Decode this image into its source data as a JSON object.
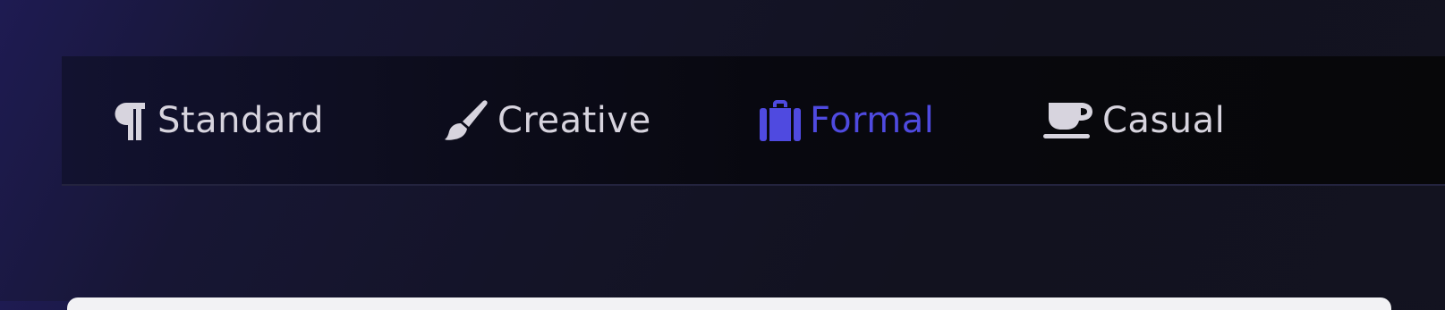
{
  "tabs": [
    {
      "id": "standard",
      "label": "Standard",
      "icon": "paragraph-icon",
      "active": false
    },
    {
      "id": "creative",
      "label": "Creative",
      "icon": "paintbrush-icon",
      "active": false
    },
    {
      "id": "formal",
      "label": "Formal",
      "icon": "briefcase-icon",
      "active": true
    },
    {
      "id": "casual",
      "label": "Casual",
      "icon": "coffee-cup-icon",
      "active": false
    }
  ],
  "colors": {
    "active_tab": "#4f4ae0",
    "inactive_tab": "#d7d4de",
    "tabbar_background": "#08080f",
    "page_background": "#141428"
  }
}
